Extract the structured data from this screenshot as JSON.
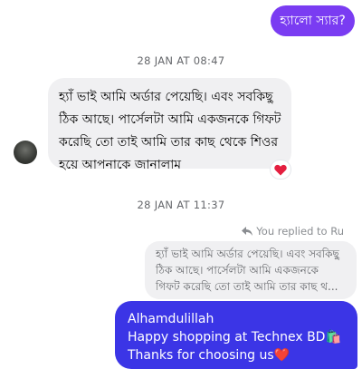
{
  "messages": {
    "top_outgoing": "হ্যালো স্যার?",
    "timestamp_1": "28 JAN AT 08:47",
    "incoming": {
      "lines": [
        "হ্যাঁ ভাই আমি অর্ডার পেয়েছি। এবং সবকিছু",
        "ঠিক আছে। পার্সেলটা আমি একজনকে গিফট",
        "করেছি তো তাই আমি তার কাছ থেকে শিওর",
        "হয়ে আপনাকে জানালাম"
      ],
      "reaction": "❤️"
    },
    "timestamp_2": "28 JAN AT 11:37",
    "replied_label": "You replied to Ru",
    "quoted_lines": [
      "হ্যাঁ ভাই আমি অর্ডার পেয়েছি। এবং সবকিছু",
      "ঠিক আছে। পার্সেলটা আমি একজনকে",
      "গিফট করেছি তো তাই আমি তার কাছ থ..."
    ],
    "reply_lines": [
      "Alhamdulillah",
      "Happy shopping at Technex BD🛍️",
      "Thanks for choosing us❤️"
    ]
  },
  "colors": {
    "outgoing_top": "#7a3cf2",
    "outgoing_reply": "#3b35e6",
    "incoming_bubble": "#f0f0f2",
    "timestamp": "#65676b"
  },
  "icons": {
    "reply_arrow": "reply-arrow-icon",
    "avatar": "avatar"
  }
}
